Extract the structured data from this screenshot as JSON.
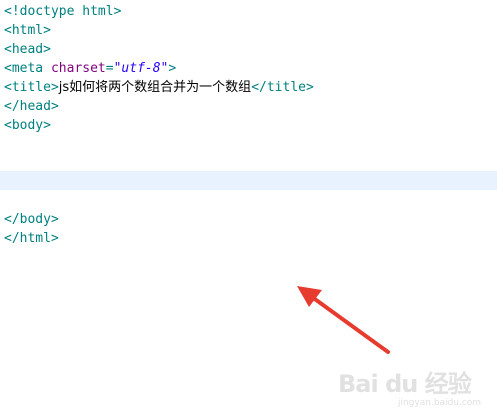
{
  "editor": {
    "lines": [
      {
        "open": "<!doctype ",
        "kw": "html",
        "close": ">"
      },
      {
        "tag": "<html>"
      },
      {
        "tag": "<head>"
      },
      {
        "open": "<meta ",
        "attr": "charset",
        "eq": "=",
        "str": "\"utf-8\"",
        "close": ">"
      },
      {
        "open": "<title>",
        "text": "js如何将两个数组合并为一个数组",
        "close": "</title>"
      },
      {
        "tag": "</head>"
      },
      {
        "tag": "<body>"
      },
      {
        "tag": ""
      },
      {
        "tag": ""
      },
      {
        "tag": ""
      },
      {
        "tag": ""
      },
      {
        "tag": "</body>"
      },
      {
        "tag": "</html>"
      }
    ]
  },
  "colors": {
    "tag": "#008080",
    "attribute": "#7f007f",
    "string": "#2a00ff",
    "current_line": "#e8f2fe",
    "arrow": "#e63b2e"
  },
  "annotation": {
    "icon": "red-arrow-icon"
  },
  "watermark": {
    "logo": "Bai du 经验",
    "sub": "jingyan.baidu.com"
  }
}
